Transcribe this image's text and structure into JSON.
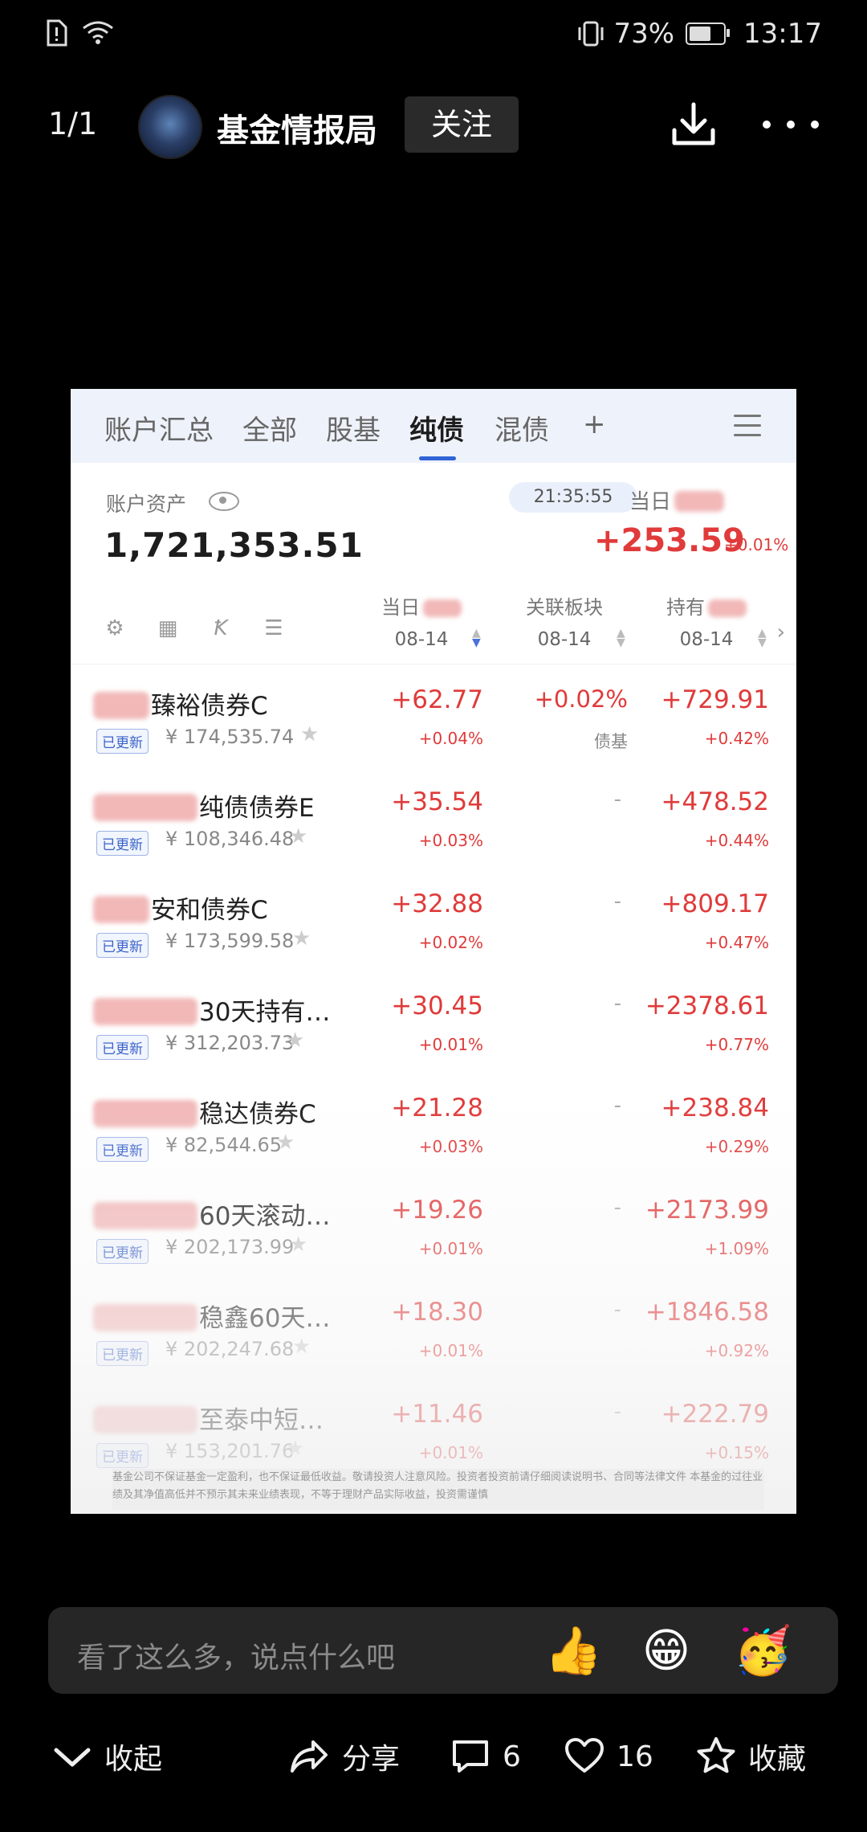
{
  "status": {
    "battery": "73%",
    "time": "13:17"
  },
  "header": {
    "page_counter": "1/1",
    "author": "基金情报局",
    "follow": "关注"
  },
  "tabs": [
    {
      "label": "账户汇总"
    },
    {
      "label": "全部"
    },
    {
      "label": "股基"
    },
    {
      "label": "纯债"
    },
    {
      "label": "混债"
    },
    {
      "label": "+"
    }
  ],
  "account": {
    "label": "账户资产",
    "value": "1,721,353.51",
    "time": "21:35:55",
    "day_label": "当日",
    "day_total": "+253.59",
    "day_total_pct": "+0.01%"
  },
  "columns": {
    "day": "当日",
    "day_date": "08-14",
    "sector": "关联板块",
    "sector_date": "08-14",
    "hold": "持有",
    "hold_date": "08-14"
  },
  "tag_updated": "已更新",
  "funds": [
    {
      "name": "臻裕债券C",
      "amount": "¥ 174,535.74",
      "day": "+62.77",
      "day_pct": "+0.04%",
      "sector": "+0.02%",
      "sector_sub": "债基",
      "hold": "+729.91",
      "hold_pct": "+0.42%"
    },
    {
      "name": "纯债债券E",
      "amount": "¥ 108,346.48",
      "day": "+35.54",
      "day_pct": "+0.03%",
      "sector": "-",
      "sector_sub": "",
      "hold": "+478.52",
      "hold_pct": "+0.44%"
    },
    {
      "name": "安和债券C",
      "amount": "¥ 173,599.58",
      "day": "+32.88",
      "day_pct": "+0.02%",
      "sector": "-",
      "sector_sub": "",
      "hold": "+809.17",
      "hold_pct": "+0.47%"
    },
    {
      "name": "30天持有…",
      "amount": "¥ 312,203.73",
      "day": "+30.45",
      "day_pct": "+0.01%",
      "sector": "-",
      "sector_sub": "",
      "hold": "+2378.61",
      "hold_pct": "+0.77%"
    },
    {
      "name": "稳达债券C",
      "amount": "¥ 82,544.65",
      "day": "+21.28",
      "day_pct": "+0.03%",
      "sector": "-",
      "sector_sub": "",
      "hold": "+238.84",
      "hold_pct": "+0.29%"
    },
    {
      "name": "60天滚动…",
      "amount": "¥ 202,173.99",
      "day": "+19.26",
      "day_pct": "+0.01%",
      "sector": "-",
      "sector_sub": "",
      "hold": "+2173.99",
      "hold_pct": "+1.09%"
    },
    {
      "name": "稳鑫60天…",
      "amount": "¥ 202,247.68",
      "day": "+18.30",
      "day_pct": "+0.01%",
      "sector": "-",
      "sector_sub": "",
      "hold": "+1846.58",
      "hold_pct": "+0.92%"
    },
    {
      "name": "至泰中短…",
      "amount": "¥ 153,201.76",
      "day": "+11.46",
      "day_pct": "+0.01%",
      "sector": "-",
      "sector_sub": "",
      "hold": "+222.79",
      "hold_pct": "+0.15%"
    }
  ],
  "disclaimer": "基金公司不保证基金一定盈利，也不保证最低收益。敬请投资人注意风险。投资者投资前请仔细阅读说明书、合同等法律文件 本基金的过往业绩及其净值高低并不预示其未来业绩表现，不等于理财产品实际收益，投资需谨慎",
  "comment": {
    "placeholder": "看了这么多，说点什么吧",
    "emojis": [
      "👍",
      "😁",
      "🥳"
    ]
  },
  "toolbar": {
    "collapse": "收起",
    "share": "分享",
    "comments": "6",
    "likes": "16",
    "favorite": "收藏"
  }
}
